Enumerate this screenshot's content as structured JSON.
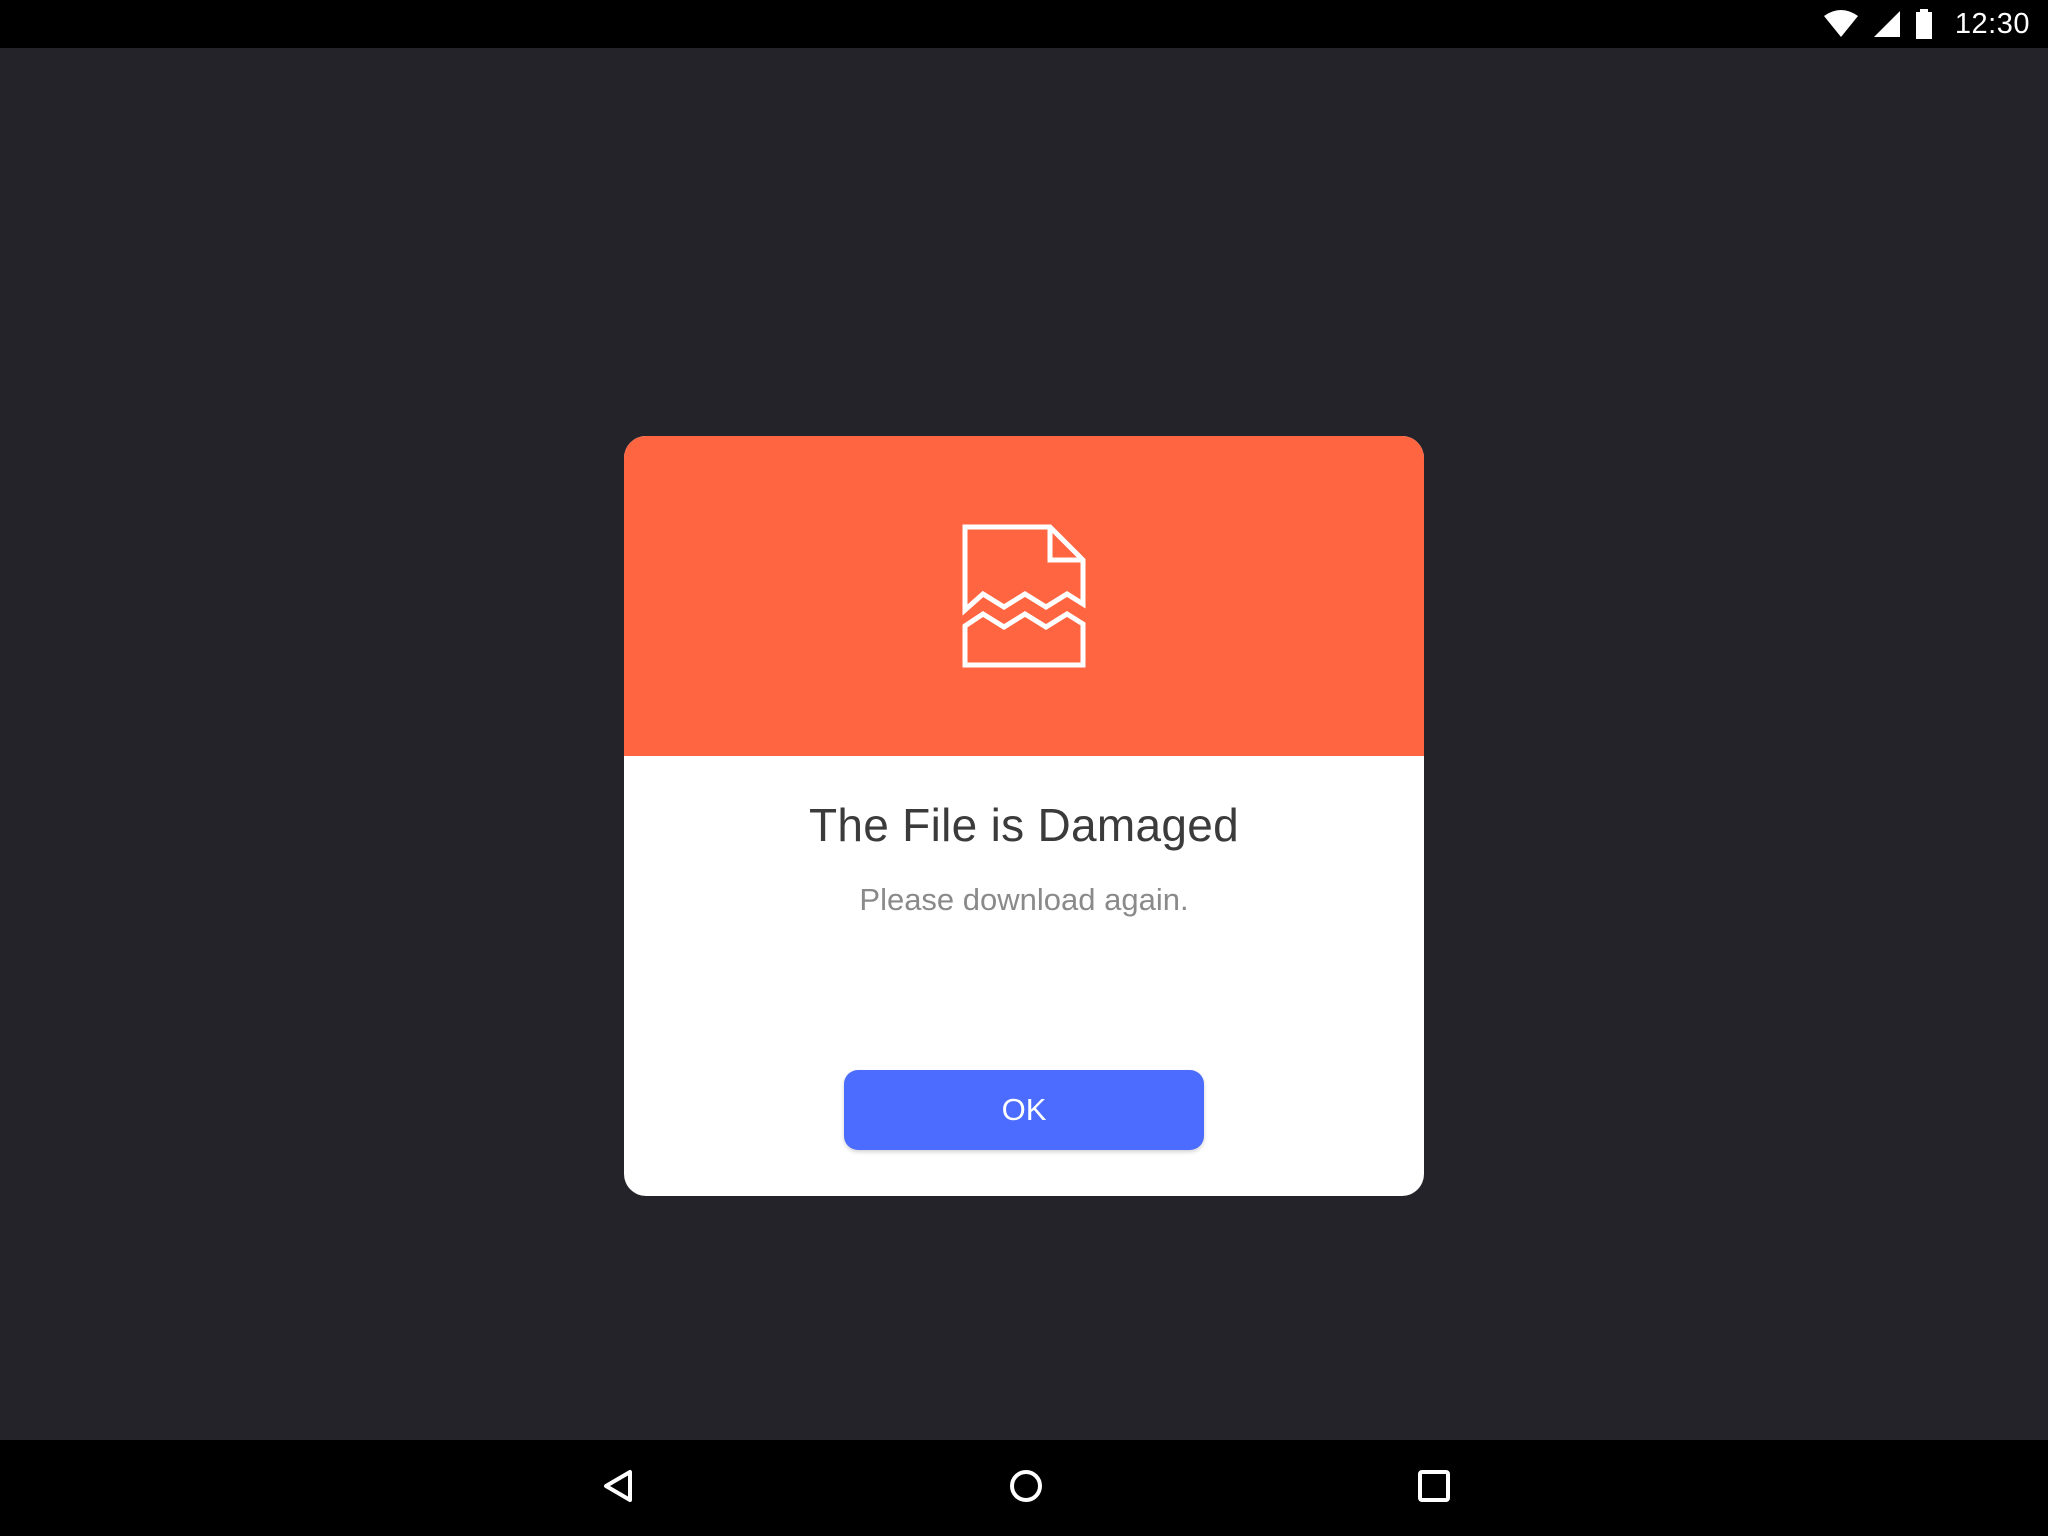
{
  "status_bar": {
    "time": "12:30",
    "icons": [
      "wifi-icon",
      "cell-signal-icon",
      "battery-icon"
    ]
  },
  "dialog": {
    "header_icon": "damaged-file-icon",
    "header_color": "#ff6540",
    "title": "The File is Damaged",
    "message": "Please download again.",
    "ok_label": "OK",
    "button_color": "#4b6cff"
  },
  "nav_bar": {
    "buttons": [
      "back-icon",
      "home-icon",
      "recents-icon"
    ]
  }
}
